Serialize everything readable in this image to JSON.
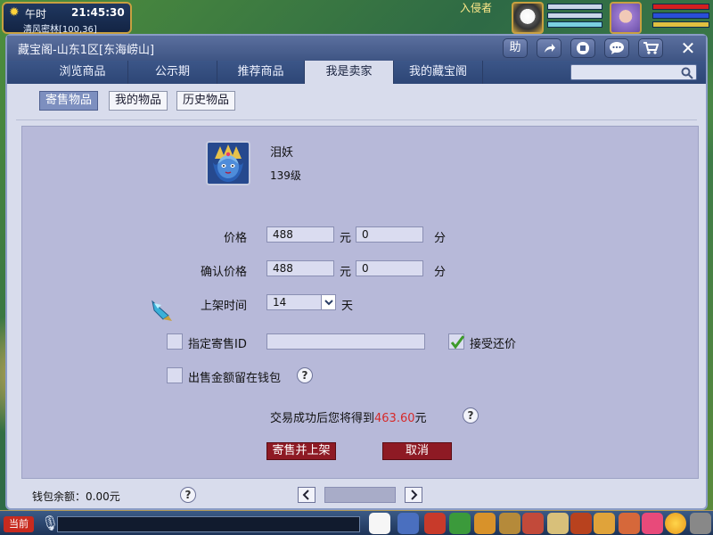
{
  "hud": {
    "period": "午时",
    "clock": "21:45:30",
    "location": "清风密林[100,36]",
    "target_name": "入侵者"
  },
  "window": {
    "title": "藏宝阁-山东1区[东海崂山]",
    "toolbar": {
      "help_label": "助",
      "share_icon": "share-arrow-icon",
      "record_icon": "stop-icon",
      "chat_icon": "chat-bubble-icon",
      "cart_icon": "shopping-cart-icon",
      "close_label": "✕"
    },
    "tabs": [
      {
        "label": "浏览商品"
      },
      {
        "label": "公示期"
      },
      {
        "label": "推荐商品"
      },
      {
        "label": "我是卖家",
        "active": true
      },
      {
        "label": "我的藏宝阁"
      }
    ],
    "search": {
      "value": ""
    }
  },
  "subtabs": [
    {
      "label": "寄售物品",
      "active": true
    },
    {
      "label": "我的物品"
    },
    {
      "label": "历史物品"
    }
  ],
  "item": {
    "name": "泪妖",
    "level": "139级"
  },
  "form": {
    "price_label": "价格",
    "price_yuan": "488",
    "yuan_unit": "元",
    "price_fen": "0",
    "fen_unit": "分",
    "confirm_label": "确认价格",
    "confirm_yuan": "488",
    "confirm_fen": "0",
    "listing_time_label": "上架时间",
    "listing_time_value": "14",
    "listing_time_unit": "天",
    "designated_label": "指定寄售ID",
    "designated_value": "",
    "accept_offer_label": "接受还价",
    "accept_offer_checked": true,
    "keep_in_wallet_label": "出售金额留在钱包",
    "keep_in_wallet_checked": false,
    "earnings_prefix": "交易成功后您将得到",
    "earnings_amount": "463.60",
    "earnings_suffix": "元"
  },
  "buttons": {
    "submit": "寄售并上架",
    "cancel": "取消"
  },
  "footer": {
    "wallet_label": "钱包余额：",
    "wallet_amount": "0.00元"
  },
  "bottom_bar": {
    "current_label": "当前"
  },
  "colors": {
    "earnings_amount": "#d62a2a",
    "accent_red": "#8e1a24",
    "window_blue": "#3f5584"
  }
}
